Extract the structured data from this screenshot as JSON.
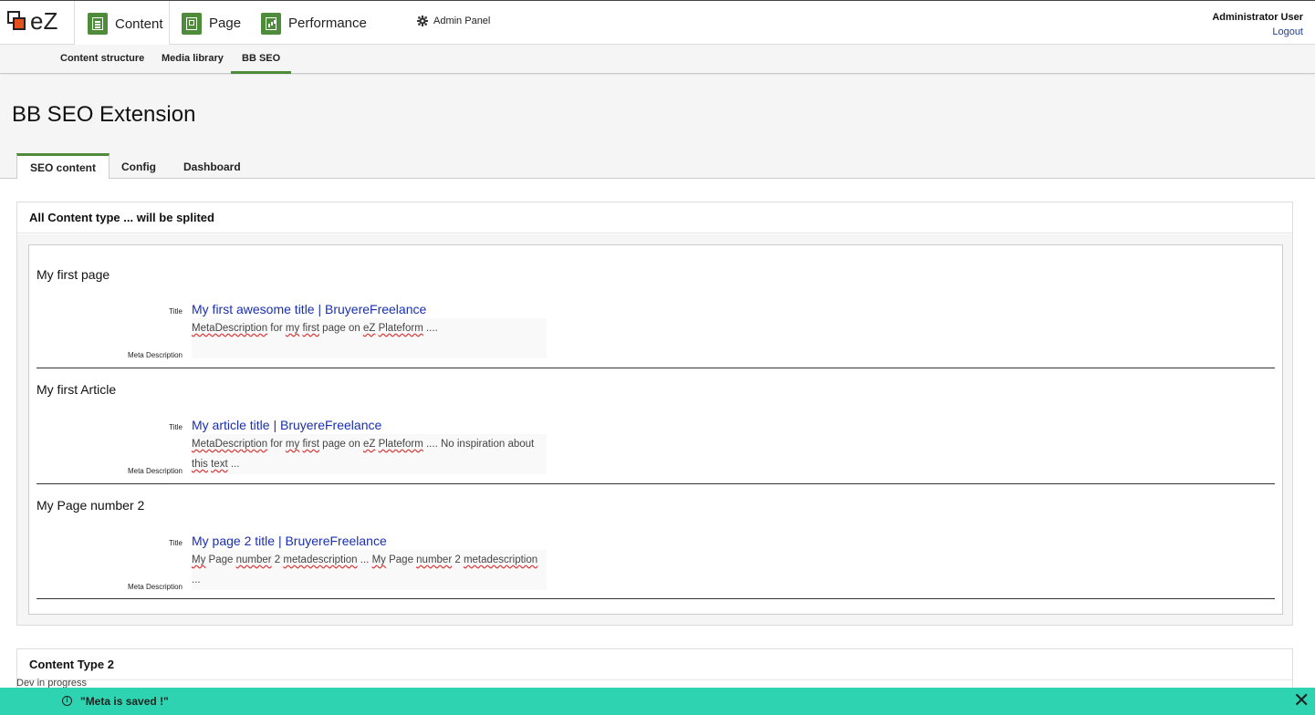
{
  "topbar": {
    "logo_text": "eZ",
    "tabs": [
      {
        "label": "Content",
        "icon": "content-icon"
      },
      {
        "label": "Page",
        "icon": "page-icon"
      },
      {
        "label": "Performance",
        "icon": "performance-icon"
      }
    ],
    "admin_panel": "Admin Panel",
    "user_name": "Administrator User",
    "logout": "Logout"
  },
  "subnav": {
    "items": [
      "Content structure",
      "Media library",
      "BB SEO"
    ],
    "active": "BB SEO"
  },
  "page": {
    "title": "BB SEO Extension",
    "tabs": [
      "SEO content",
      "Config",
      "Dashboard"
    ],
    "active_tab": "SEO content"
  },
  "panel1": {
    "header": "All Content type ... will be splited",
    "entries": [
      {
        "name": "My first page",
        "title_label": "Title",
        "title": "My first awesome title | BruyereFreelance",
        "meta_label": "Meta Description",
        "meta_line1": "MetaDescription for my first page on eZ Plateform ....",
        "meta_line2": ""
      },
      {
        "name": "My first Article",
        "title_label": "Title",
        "title": "My article  title | BruyereFreelance",
        "meta_label": "Meta Description",
        "meta_line1": "MetaDescription for my first page on eZ Plateform .... No inspiration about",
        "meta_line2": "this text ..."
      },
      {
        "name": "My Page number 2",
        "title_label": "Title",
        "title": "My page 2   title | BruyereFreelance",
        "meta_label": "Meta Description",
        "meta_line1": "My Page number 2 metadescription ... My Page number 2 metadescription ...",
        "meta_line2": ""
      }
    ]
  },
  "panel2": {
    "header": "Content Type 2",
    "progress": "Dev in progress"
  },
  "notification": {
    "icon": "info-icon",
    "text": "\"Meta is saved !\"",
    "close": "✕",
    "color": "#2ed4b1"
  },
  "colors": {
    "accent": "#4e8b3a",
    "link": "#1a2fb0"
  }
}
